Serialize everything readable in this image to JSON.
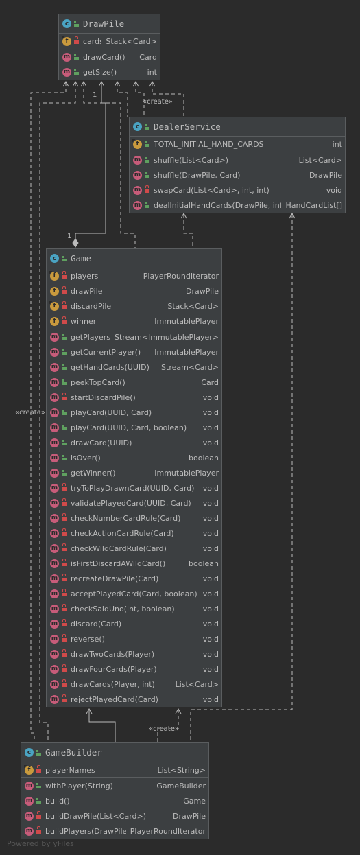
{
  "classes": {
    "draw_pile": {
      "title": "DrawPile",
      "fields": [
        {
          "name": "cards",
          "type": "Stack<Card>",
          "vis": "private",
          "final": true
        }
      ],
      "methods": [
        {
          "name": "drawCard()",
          "type": "Card",
          "vis": "public"
        },
        {
          "name": "getSize()",
          "type": "int",
          "vis": "public"
        }
      ]
    },
    "dealer_service": {
      "title": "DealerService",
      "fields": [
        {
          "name": "TOTAL_INITIAL_HAND_CARDS",
          "type": "int",
          "vis": "public",
          "final": true
        }
      ],
      "methods": [
        {
          "name": "shuffle(List<Card>)",
          "type": "List<Card>",
          "vis": "public"
        },
        {
          "name": "shuffle(DrawPile, Card)",
          "type": "DrawPile",
          "vis": "public"
        },
        {
          "name": "swapCard(List<Card>, int, int)",
          "type": "void",
          "vis": "private"
        },
        {
          "name": "dealInitialHandCards(DrawPile, int)",
          "type": "HandCardList[]",
          "vis": "public"
        }
      ]
    },
    "game": {
      "title": "Game",
      "fields": [
        {
          "name": "players",
          "type": "PlayerRoundIterator",
          "vis": "private",
          "final": true
        },
        {
          "name": "drawPile",
          "type": "DrawPile",
          "vis": "private",
          "final": false
        },
        {
          "name": "discardPile",
          "type": "Stack<Card>",
          "vis": "private",
          "final": true
        },
        {
          "name": "winner",
          "type": "ImmutablePlayer",
          "vis": "private",
          "final": false
        }
      ],
      "methods": [
        {
          "name": "getPlayers()",
          "type": "Stream<ImmutablePlayer>",
          "vis": "public"
        },
        {
          "name": "getCurrentPlayer()",
          "type": "ImmutablePlayer",
          "vis": "public"
        },
        {
          "name": "getHandCards(UUID)",
          "type": "Stream<Card>",
          "vis": "public"
        },
        {
          "name": "peekTopCard()",
          "type": "Card",
          "vis": "public"
        },
        {
          "name": "startDiscardPile()",
          "type": "void",
          "vis": "private"
        },
        {
          "name": "playCard(UUID, Card)",
          "type": "void",
          "vis": "public"
        },
        {
          "name": "playCard(UUID, Card, boolean)",
          "type": "void",
          "vis": "public"
        },
        {
          "name": "drawCard(UUID)",
          "type": "void",
          "vis": "public"
        },
        {
          "name": "isOver()",
          "type": "boolean",
          "vis": "public"
        },
        {
          "name": "getWinner()",
          "type": "ImmutablePlayer",
          "vis": "public"
        },
        {
          "name": "tryToPlayDrawnCard(UUID, Card)",
          "type": "void",
          "vis": "private"
        },
        {
          "name": "validatePlayedCard(UUID, Card)",
          "type": "void",
          "vis": "private"
        },
        {
          "name": "checkNumberCardRule(Card)",
          "type": "void",
          "vis": "private"
        },
        {
          "name": "checkActionCardRule(Card)",
          "type": "void",
          "vis": "private"
        },
        {
          "name": "checkWildCardRule(Card)",
          "type": "void",
          "vis": "private"
        },
        {
          "name": "isFirstDiscardAWildCard()",
          "type": "boolean",
          "vis": "private"
        },
        {
          "name": "recreateDrawPile(Card)",
          "type": "void",
          "vis": "private"
        },
        {
          "name": "acceptPlayedCard(Card, boolean)",
          "type": "void",
          "vis": "private"
        },
        {
          "name": "checkSaidUno(int, boolean)",
          "type": "void",
          "vis": "private"
        },
        {
          "name": "discard(Card)",
          "type": "void",
          "vis": "private"
        },
        {
          "name": "reverse()",
          "type": "void",
          "vis": "private"
        },
        {
          "name": "drawTwoCards(Player)",
          "type": "void",
          "vis": "private"
        },
        {
          "name": "drawFourCards(Player)",
          "type": "void",
          "vis": "private"
        },
        {
          "name": "drawCards(Player, int)",
          "type": "List<Card>",
          "vis": "private"
        },
        {
          "name": "rejectPlayedCard(Card)",
          "type": "void",
          "vis": "private"
        }
      ]
    },
    "game_builder": {
      "title": "GameBuilder",
      "fields": [
        {
          "name": "playerNames",
          "type": "List<String>",
          "vis": "private",
          "final": true
        }
      ],
      "methods": [
        {
          "name": "withPlayer(String)",
          "type": "GameBuilder",
          "vis": "public"
        },
        {
          "name": "build()",
          "type": "Game",
          "vis": "public"
        },
        {
          "name": "buildDrawPile(List<Card>)",
          "type": "DrawPile",
          "vis": "private"
        },
        {
          "name": "buildPlayers(DrawPile)",
          "type": "PlayerRoundIterator",
          "vis": "private"
        }
      ]
    }
  },
  "edge_labels": {
    "create_dealer": "«create»",
    "create_game_side": "«create»",
    "create_builder": "«create»",
    "mult_top": "1",
    "mult_bottom": "1"
  },
  "footer": "Powered by yFiles",
  "colors": {
    "background": "#2b2b2b",
    "box": "#3c3f41",
    "border": "#5a5d5f",
    "edge": "#bbbbbb"
  }
}
